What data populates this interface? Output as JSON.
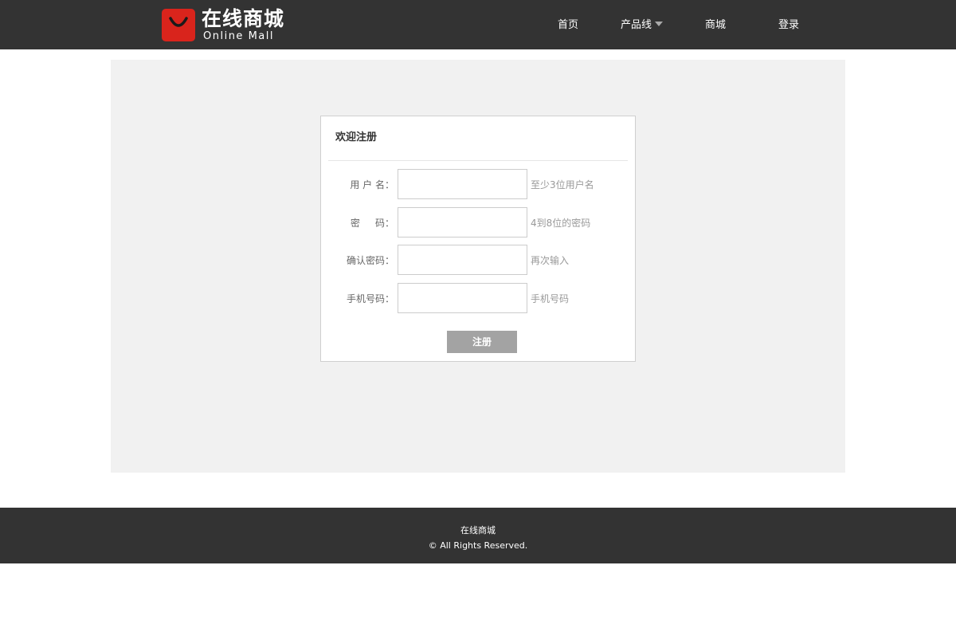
{
  "header": {
    "logo_cn": "在线商城",
    "logo_en": "Online Mall",
    "logo_icon": "shopping-bag-icon",
    "nav": [
      {
        "label": "首页"
      },
      {
        "label": "产品线",
        "has_dropdown": true
      },
      {
        "label": "商城"
      },
      {
        "label": "登录"
      }
    ]
  },
  "register": {
    "title": "欢迎注册",
    "fields": [
      {
        "label": "用 户 名：",
        "value": "",
        "hint": "至少3位用户名"
      },
      {
        "label": "密     码：",
        "value": "",
        "hint": "4到8位的密码"
      },
      {
        "label": "确认密码：",
        "value": "",
        "hint": "再次输入"
      },
      {
        "label": "手机号码：",
        "value": "",
        "hint": "手机号码"
      }
    ],
    "submit_label": "注册"
  },
  "footer": {
    "name": "在线商城",
    "copyright": "© All Rights Reserved."
  },
  "colors": {
    "header_bg": "#333333",
    "logo_red": "#d9241c",
    "panel_bg": "#f1f1f1",
    "button_bg": "#a3a3a3",
    "hint_text": "#999999"
  }
}
